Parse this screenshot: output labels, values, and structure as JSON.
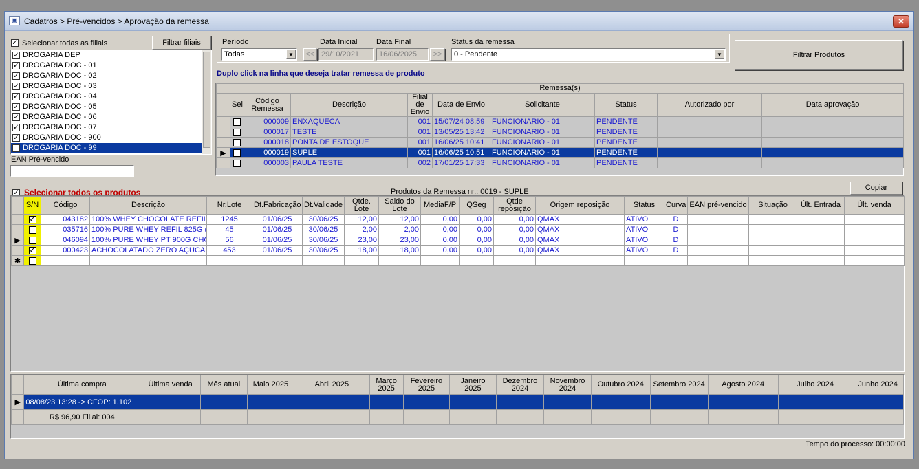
{
  "window": {
    "title": "Cadatros > Pré-vencidos > Aprovação da remessa",
    "close": "✕"
  },
  "filiais": {
    "select_all_label": "Selecionar todas as filiais",
    "filter_button": "Filtrar filiais",
    "items": [
      {
        "label": "DROGARIA DEP",
        "checked": true
      },
      {
        "label": "DROGARIA DOC - 01",
        "checked": true
      },
      {
        "label": "DROGARIA DOC - 02",
        "checked": true
      },
      {
        "label": "DROGARIA DOC - 03",
        "checked": true
      },
      {
        "label": "DROGARIA DOC - 04",
        "checked": true
      },
      {
        "label": "DROGARIA DOC - 05",
        "checked": true
      },
      {
        "label": "DROGARIA DOC - 06",
        "checked": true
      },
      {
        "label": "DROGARIA DOC - 07",
        "checked": true
      },
      {
        "label": "DROGARIA DOC - 900",
        "checked": true
      },
      {
        "label": "DROGARIA DOC - 99",
        "checked": true,
        "selected": true
      }
    ],
    "ean_label": "EAN Pré-vencido",
    "ean_value": ""
  },
  "filters": {
    "periodo_label": "Período",
    "periodo_value": "Todas",
    "data_inicial_label": "Data Inicial",
    "data_inicial_value": "29/10/2021",
    "data_final_label": "Data Final",
    "data_final_value": "16/06/2025",
    "prev_btn": "<<",
    "next_btn": ">>",
    "status_label": "Status da remessa",
    "status_value": "0 - Pendente",
    "filter_products_button": "Filtrar Produtos",
    "hint": "Duplo click na linha que deseja tratar remessa de produto"
  },
  "remessas": {
    "caption": "Remessa(s)",
    "headers": [
      "Sel",
      "Código Remessa",
      "Descrição",
      "Filial de Envio",
      "Data de Envio",
      "Solicitante",
      "Status",
      "Autorizado por",
      "Data aprovação"
    ],
    "rows": [
      {
        "codigo": "000009",
        "descricao": "ENXAQUECA",
        "filial": "001",
        "data": "15/07/24 08:59",
        "solicitante": "FUNCIONARIO - 01",
        "status": "PENDENTE",
        "autorizado": "",
        "aprovacao": ""
      },
      {
        "codigo": "000017",
        "descricao": "TESTE",
        "filial": "001",
        "data": "13/05/25 13:42",
        "solicitante": "FUNCIONARIO - 01",
        "status": "PENDENTE",
        "autorizado": "",
        "aprovacao": ""
      },
      {
        "codigo": "000018",
        "descricao": "PONTA DE ESTOQUE",
        "filial": "001",
        "data": "16/06/25 10:41",
        "solicitante": "FUNCIONARIO - 01",
        "status": "PENDENTE",
        "autorizado": "",
        "aprovacao": ""
      },
      {
        "codigo": "000019",
        "descricao": "SUPLE",
        "filial": "001",
        "data": "16/06/25 10:51",
        "solicitante": "FUNCIONARIO - 01",
        "status": "PENDENTE",
        "autorizado": "",
        "aprovacao": "",
        "selected": true
      },
      {
        "codigo": "000003",
        "descricao": "PAULA TESTE",
        "filial": "002",
        "data": "17/01/25 17:33",
        "solicitante": "FUNCIONARIO - 01",
        "status": "PENDENTE",
        "autorizado": "",
        "aprovacao": ""
      }
    ]
  },
  "produtos": {
    "select_all_label": "Selecionar todos os produtos",
    "caption": "Produtos da Remessa nr.: 0019 - SUPLE",
    "copy_button": "Copiar",
    "headers": [
      "S/N",
      "Código",
      "Descrição",
      "Nr.Lote",
      "Dt.Fabricação",
      "Dt.Validade",
      "Qtde. Lote",
      "Saldo do Lote",
      "MediaF/P",
      "QSeg",
      "Qtde reposição",
      "Origem reposição",
      "Status",
      "Curva",
      "EAN pré-vencido",
      "Situação",
      "Últ. Entrada",
      "Últ. venda"
    ],
    "rows": [
      {
        "sn": true,
        "codigo": "043182",
        "descricao": "100% WHEY CHOCOLATE REFIL",
        "lote": "1245",
        "fab": "01/06/25",
        "val": "30/06/25",
        "qtde": "12,00",
        "saldo": "12,00",
        "media": "0,00",
        "qseg": "0,00",
        "reposicao": "0,00",
        "origem": "QMAX",
        "status": "ATIVO",
        "curva": "D",
        "ean": "",
        "situacao": "",
        "ult_entrada": "",
        "ult_venda": ""
      },
      {
        "sn": false,
        "codigo": "035716",
        "descricao": "100% PURE WHEY REFIL 825G (",
        "lote": "45",
        "fab": "01/06/25",
        "val": "30/06/25",
        "qtde": "2,00",
        "saldo": "2,00",
        "media": "0,00",
        "qseg": "0,00",
        "reposicao": "0,00",
        "origem": "QMAX",
        "status": "ATIVO",
        "curva": "D",
        "ean": "",
        "situacao": "",
        "ult_entrada": "",
        "ult_venda": ""
      },
      {
        "sn": false,
        "codigo": "046094",
        "descricao": "100% PURE WHEY PT 900G CHC",
        "lote": "56",
        "fab": "01/06/25",
        "val": "30/06/25",
        "qtde": "23,00",
        "saldo": "23,00",
        "media": "0,00",
        "qseg": "0,00",
        "reposicao": "0,00",
        "origem": "QMAX",
        "status": "ATIVO",
        "curva": "D",
        "ean": "",
        "situacao": "",
        "ult_entrada": "",
        "ult_venda": "",
        "current": true
      },
      {
        "sn": true,
        "codigo": "000423",
        "descricao": "ACHOCOLATADO ZERO AÇUCAF",
        "lote": "453",
        "fab": "01/06/25",
        "val": "30/06/25",
        "qtde": "18,00",
        "saldo": "18,00",
        "media": "0,00",
        "qseg": "0,00",
        "reposicao": "0,00",
        "origem": "QMAX",
        "status": "ATIVO",
        "curva": "D",
        "ean": "",
        "situacao": "",
        "ult_entrada": "",
        "ult_venda": ""
      }
    ]
  },
  "historico": {
    "headers": [
      "Última compra",
      "Última venda",
      "Mês atual",
      "Maio 2025",
      "Abril 2025",
      "Março 2025",
      "Fevereiro 2025",
      "Janeiro 2025",
      "Dezembro 2024",
      "Novembro 2024",
      "Outubro 2024",
      "Setembro 2024",
      "Agosto 2024",
      "Julho 2024",
      "Junho 2024"
    ],
    "row1_first": "08/08/23 13:28 -> CFOP: 1.102",
    "row2_first": "R$ 96,90 Filial: 004"
  },
  "status_bar": {
    "tempo": "Tempo do processo: 00:00:00"
  }
}
